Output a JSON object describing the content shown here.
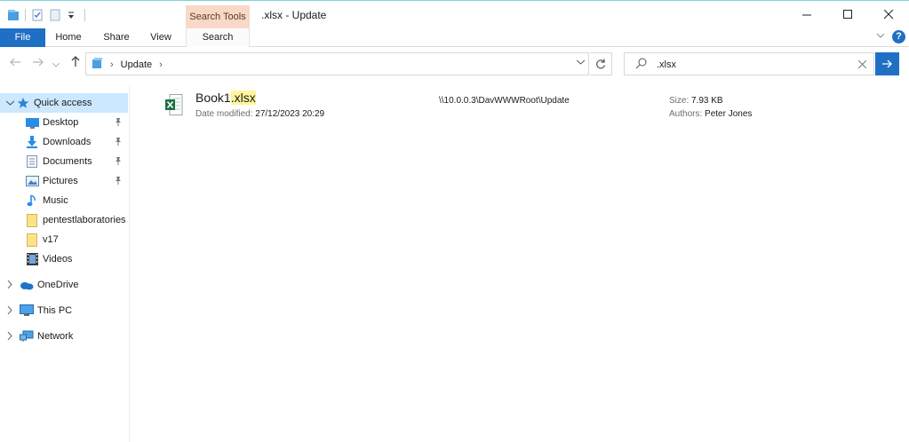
{
  "window": {
    "title": ".xlsx - Update",
    "context_tab_header": "Search Tools"
  },
  "ribbon": {
    "tabs": [
      {
        "label": "File"
      },
      {
        "label": "Home"
      },
      {
        "label": "Share"
      },
      {
        "label": "View"
      },
      {
        "label": "Search"
      }
    ]
  },
  "address": {
    "crumbs": [
      "Update"
    ]
  },
  "search": {
    "value": ".xlsx"
  },
  "nav": {
    "quick_access": "Quick access",
    "items": [
      {
        "label": "Desktop",
        "icon": "desktop-icon",
        "pinned": true
      },
      {
        "label": "Downloads",
        "icon": "downloads-icon",
        "pinned": true
      },
      {
        "label": "Documents",
        "icon": "documents-icon",
        "pinned": true
      },
      {
        "label": "Pictures",
        "icon": "pictures-icon",
        "pinned": true
      },
      {
        "label": "Music",
        "icon": "music-icon",
        "pinned": false
      },
      {
        "label": "pentestlaboratories",
        "icon": "folder-icon",
        "pinned": false
      },
      {
        "label": "v17",
        "icon": "folder-icon",
        "pinned": false
      },
      {
        "label": "Videos",
        "icon": "videos-icon",
        "pinned": false
      }
    ],
    "roots": [
      {
        "label": "OneDrive",
        "icon": "onedrive-icon"
      },
      {
        "label": "This PC",
        "icon": "this-pc-icon"
      },
      {
        "label": "Network",
        "icon": "network-icon"
      }
    ]
  },
  "result": {
    "name_base": "Book1",
    "name_match": ".xlsx",
    "date_label": "Date modified:",
    "date_value": "27/12/2023 20:29",
    "path": "\\\\10.0.0.3\\DavWWWRoot\\Update",
    "size_label": "Size:",
    "size_value": "7.93 KB",
    "authors_label": "Authors:",
    "authors_value": "Peter Jones"
  },
  "colors": {
    "accent": "#1f6fc5",
    "selection": "#cce8ff",
    "context_tab": "#f8d9c8",
    "highlight": "#fff59d",
    "excel": "#1d7044"
  }
}
